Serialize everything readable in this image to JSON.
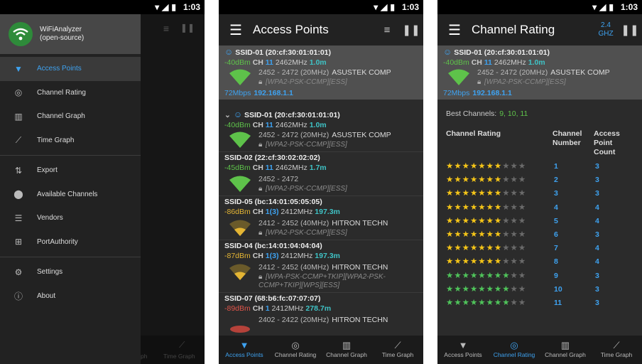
{
  "status": {
    "time": "1:03"
  },
  "drawer": {
    "app_title_line1": "WiFiAnalyzer",
    "app_title_line2": "(open-source)",
    "items": [
      {
        "label": "Access Points",
        "icon": "wifi-icon",
        "selected": true
      },
      {
        "label": "Channel Rating",
        "icon": "signal-radar-icon"
      },
      {
        "label": "Channel Graph",
        "icon": "bar-chart-icon"
      },
      {
        "label": "Time Graph",
        "icon": "line-chart-icon"
      },
      {
        "label": "Export",
        "icon": "export-icon"
      },
      {
        "label": "Available Channels",
        "icon": "location-pin-icon"
      },
      {
        "label": "Vendors",
        "icon": "list-icon"
      },
      {
        "label": "PortAuthority",
        "icon": "network-icon"
      },
      {
        "label": "Settings",
        "icon": "gear-icon"
      },
      {
        "label": "About",
        "icon": "info-icon"
      }
    ]
  },
  "bottom_nav": [
    "Access Points",
    "Channel Rating",
    "Channel Graph",
    "Time Graph"
  ],
  "bg_nav_partial": [
    "ph",
    "Time Graph"
  ],
  "access_points": {
    "title": "Access Points",
    "connected": {
      "ssid": "SSID-01 (20:cf:30:01:01:01)",
      "level": "-40dBm",
      "ch_label": "CH",
      "ch": "11",
      "freq": "2462MHz",
      "dist": "1.0m",
      "range": "2452 - 2472 (20MHz)",
      "vendor": "ASUSTEK COMP",
      "security": "[WPA2-PSK-CCMP][ESS]",
      "speed": "72Mbps",
      "ip": "192.168.1.1"
    },
    "list": [
      {
        "ssid": "SSID-01 (20:cf:30:01:01:01)",
        "level": "-40dBm",
        "level_class": "g",
        "ch": "11",
        "freq": "2462MHz",
        "dist": "1.0m",
        "range": "2452 - 2472 (20MHz)",
        "vendor": "ASUSTEK COMP",
        "security": "[WPA2-PSK-CCMP][ESS]",
        "strength": "green"
      },
      {
        "ssid": "SSID-02 (22:cf:30:02:02:02)",
        "level": "-45dBm",
        "level_class": "g",
        "ch": "11",
        "freq": "2462MHz",
        "dist": "1.7m",
        "range": "2452 - 2472",
        "vendor": "",
        "security": "[WPA2-PSK-CCMP][ESS]",
        "strength": "green"
      },
      {
        "ssid": "SSID-05 (bc:14:01:05:05:05)",
        "level": "-86dBm",
        "level_class": "y",
        "ch": "1(3)",
        "freq": "2412MHz",
        "dist": "197.3m",
        "range": "2412 - 2452 (40MHz)",
        "vendor": "HITRON TECHN",
        "security": "[WPA2-PSK-CCMP][ESS]",
        "strength": "yellow"
      },
      {
        "ssid": "SSID-04 (bc:14:01:04:04:04)",
        "level": "-87dBm",
        "level_class": "y",
        "ch": "1(3)",
        "freq": "2412MHz",
        "dist": "197.3m",
        "range": "2412 - 2452 (40MHz)",
        "vendor": "HITRON TECHN",
        "security": "[WPA-PSK-CCMP+TKIP][WPA2-PSK-CCMP+TKIP][WPS][ESS]",
        "strength": "yellow"
      },
      {
        "ssid": "SSID-07 (68:b6:fc:07:07:07)",
        "level": "-89dBm",
        "level_class": "r",
        "ch": "1",
        "freq": "2412MHz",
        "dist": "278.7m",
        "range": "2402 - 2422 (20MHz)",
        "vendor": "HITRON TECHN",
        "security": "",
        "strength": "red"
      }
    ]
  },
  "channel_rating": {
    "title": "Channel Rating",
    "band_line1": "2.4",
    "band_line2": "GHZ",
    "best_label": "Best Channels:",
    "best_values": "9, 10, 11",
    "col_rating": "Channel Rating",
    "col_number_1": "Channel",
    "col_number_2": "Number",
    "col_count_1": "Access",
    "col_count_2": "Point",
    "col_count_3": "Count",
    "rows": [
      {
        "channel": "1",
        "count": "3",
        "stars": 6,
        "half": true,
        "color": "y"
      },
      {
        "channel": "2",
        "count": "3",
        "stars": 6,
        "half": true,
        "color": "y"
      },
      {
        "channel": "3",
        "count": "3",
        "stars": 6,
        "half": true,
        "color": "y"
      },
      {
        "channel": "4",
        "count": "4",
        "stars": 6,
        "half": true,
        "color": "y"
      },
      {
        "channel": "5",
        "count": "4",
        "stars": 6,
        "half": true,
        "color": "y"
      },
      {
        "channel": "6",
        "count": "3",
        "stars": 6,
        "half": true,
        "color": "y"
      },
      {
        "channel": "7",
        "count": "4",
        "stars": 6,
        "half": true,
        "color": "y"
      },
      {
        "channel": "8",
        "count": "4",
        "stars": 6,
        "half": true,
        "color": "y"
      },
      {
        "channel": "9",
        "count": "3",
        "stars": 8,
        "half": false,
        "color": "g"
      },
      {
        "channel": "10",
        "count": "3",
        "stars": 8,
        "half": false,
        "color": "g"
      },
      {
        "channel": "11",
        "count": "3",
        "stars": 8,
        "half": false,
        "color": "g"
      }
    ]
  },
  "colors": {
    "accent": "#3ea2f0",
    "good": "#5ec24a",
    "fair": "#e4b534",
    "weak": "#e0554a",
    "star": "#f5c518"
  }
}
